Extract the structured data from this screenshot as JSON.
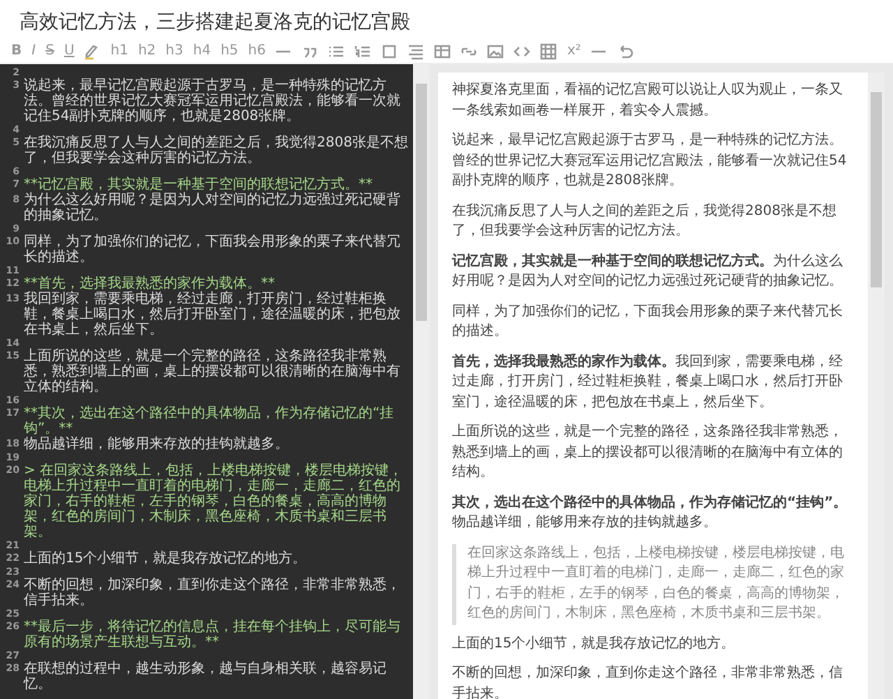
{
  "window": {
    "title": "高效记忆方法，三步搭建起夏洛克的记忆宫殿"
  },
  "toolbar": [
    {
      "kind": "bold",
      "label": "B"
    },
    {
      "kind": "italic",
      "label": "I"
    },
    {
      "kind": "strike",
      "label": "S"
    },
    {
      "kind": "underline",
      "label": "U"
    },
    {
      "kind": "highlight"
    },
    {
      "kind": "text",
      "label": "h1"
    },
    {
      "kind": "text",
      "label": "h2"
    },
    {
      "kind": "text",
      "label": "h3"
    },
    {
      "kind": "text",
      "label": "h4"
    },
    {
      "kind": "text",
      "label": "h5"
    },
    {
      "kind": "text",
      "label": "h6"
    },
    {
      "kind": "rule"
    },
    {
      "kind": "quote"
    },
    {
      "kind": "bullets"
    },
    {
      "kind": "numbers"
    },
    {
      "kind": "square"
    },
    {
      "kind": "lines"
    },
    {
      "kind": "table"
    },
    {
      "kind": "link"
    },
    {
      "kind": "image"
    },
    {
      "kind": "code"
    },
    {
      "kind": "grid"
    },
    {
      "kind": "text",
      "label": "x²"
    },
    {
      "kind": "rule"
    },
    {
      "kind": "undo"
    }
  ],
  "editor": {
    "lines": [
      {
        "n": "2",
        "kind": "plain"
      },
      {
        "n": "3",
        "kind": "plain",
        "text": "说起来，最早记忆宫殿起源于古罗马，是一种特殊的记忆方法。曾经的世界记忆大赛冠军运用记忆宫殿法，能够看一次就记住54副扑克牌的顺序，也就是2808张牌。"
      },
      {
        "n": "4",
        "kind": "plain"
      },
      {
        "n": "5",
        "kind": "plain",
        "text": "在我沉痛反思了人与人之间的差距之后，我觉得2808张是不想了，但我要学会这种厉害的记忆方法。"
      },
      {
        "n": "6",
        "kind": "plain"
      },
      {
        "n": "7",
        "kind": "strong",
        "text": "**记忆宫殿，其实就是一种基于空间的联想记忆方式。**"
      },
      {
        "n": "8",
        "kind": "plain",
        "text": "为什么这么好用呢？是因为人对空间的记忆力远强过死记硬背的抽象记忆。"
      },
      {
        "n": "9",
        "kind": "plain"
      },
      {
        "n": "10",
        "kind": "plain",
        "text": "同样，为了加强你们的记忆，下面我会用形象的栗子来代替冗长的描述。"
      },
      {
        "n": "11",
        "kind": "plain"
      },
      {
        "n": "12",
        "kind": "strong",
        "text": "**首先，选择我最熟悉的家作为载体。**"
      },
      {
        "n": "13",
        "kind": "plain",
        "text": "我回到家，需要乘电梯，经过走廊，打开房门，经过鞋柜换鞋，餐桌上喝口水，然后打开卧室门，途径温暖的床，把包放在书桌上，然后坐下。"
      },
      {
        "n": "14",
        "kind": "plain"
      },
      {
        "n": "15",
        "kind": "plain",
        "text": "上面所说的这些，就是一个完整的路径，这条路径我非常熟悉，熟悉到墙上的画，桌上的摆设都可以很清晰的在脑海中有立体的结构。"
      },
      {
        "n": "16",
        "kind": "plain"
      },
      {
        "n": "17",
        "kind": "strong",
        "text": "**其次，选出在这个路径中的具体物品，作为存储记忆的“挂钩”。**"
      },
      {
        "n": "18",
        "kind": "plain",
        "text": "物品越详细，能够用来存放的挂钩就越多。"
      },
      {
        "n": "19",
        "kind": "plain"
      },
      {
        "n": "20",
        "kind": "quote",
        "text": "> 在回家这条路线上，包括，上楼电梯按键，楼层电梯按键，电梯上升过程中一直盯着的电梯门，走廊一，走廊二，红色的家门，右手的鞋柜，左手的钢琴，白色的餐桌，高高的博物架，红色的房间门，木制床，黑色座椅，木质书桌和三层书架。"
      },
      {
        "n": "21",
        "kind": "plain"
      },
      {
        "n": "22",
        "kind": "plain",
        "text": "上面的15个小细节，就是我存放记忆的地方。"
      },
      {
        "n": "23",
        "kind": "plain"
      },
      {
        "n": "24",
        "kind": "plain",
        "text": "不断的回想，加深印象，直到你走这个路径，非常非常熟悉，信手拈来。"
      },
      {
        "n": "25",
        "kind": "plain"
      },
      {
        "n": "26",
        "kind": "strong",
        "text": "**最后一步，将待记忆的信息点，挂在每个挂钩上，尽可能与原有的场景产生联想与互动。**"
      },
      {
        "n": "27",
        "kind": "plain"
      },
      {
        "n": "28",
        "kind": "plain",
        "text": "在联想的过程中，越生动形象，越与自身相关联，越容易记忆。"
      }
    ]
  },
  "preview": {
    "blocks": [
      {
        "kind": "para",
        "text": "神探夏洛克里面，看福的记忆宫殿可以说让人叹为观止，一条又一条线索如画卷一样展开，着实令人震撼。"
      },
      {
        "kind": "para",
        "text": "说起来，最早记忆宫殿起源于古罗马，是一种特殊的记忆方法。曾经的世界记忆大赛冠军运用记忆宫殿法，能够看一次就记住54副扑克牌的顺序，也就是2808张牌。"
      },
      {
        "kind": "para",
        "text": "在我沉痛反思了人与人之间的差距之后，我觉得2808张是不想了，但我要学会这种厉害的记忆方法。"
      },
      {
        "kind": "para",
        "text": "**记忆宫殿，其实就是一种基于空间的联想记忆方式。**为什么这么好用呢？是因为人对空间的记忆力远强过死记硬背的抽象记忆。"
      },
      {
        "kind": "para",
        "text": "同样，为了加强你们的记忆，下面我会用形象的栗子来代替冗长的描述。"
      },
      {
        "kind": "para",
        "text": "**首先，选择我最熟悉的家作为载体。**我回到家，需要乘电梯，经过走廊，打开房门，经过鞋柜换鞋，餐桌上喝口水，然后打开卧室门，途径温暖的床，把包放在书桌上，然后坐下。"
      },
      {
        "kind": "para",
        "text": "上面所说的这些，就是一个完整的路径，这条路径我非常熟悉，熟悉到墙上的画，桌上的摆设都可以很清晰的在脑海中有立体的结构。"
      },
      {
        "kind": "para",
        "text": "**其次，选出在这个路径中的具体物品，作为存储记忆的“挂钩”。**物品越详细，能够用来存放的挂钩就越多。"
      },
      {
        "kind": "quote",
        "text": "在回家这条路线上，包括，上楼电梯按键，楼层电梯按键，电梯上升过程中一直盯着的电梯门，走廊一，走廊二，红色的家门，右手的鞋柜，左手的钢琴，白色的餐桌，高高的博物架，红色的房间门，木制床，黑色座椅，木质书桌和三层书架。"
      },
      {
        "kind": "para",
        "text": "上面的15个小细节，就是我存放记忆的地方。"
      },
      {
        "kind": "para",
        "text": "不断的回想，加深印象，直到你走这个路径，非常非常熟悉，信手拈来。"
      }
    ]
  }
}
